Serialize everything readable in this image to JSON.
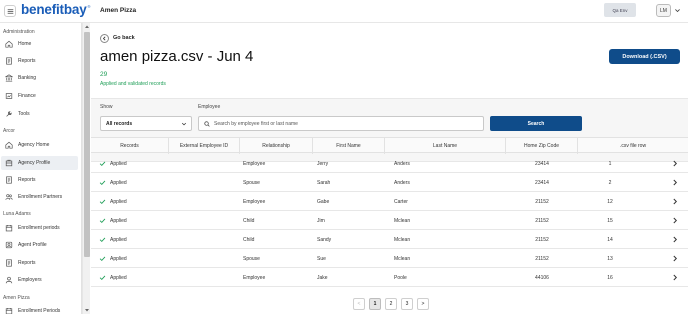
{
  "header": {
    "logo_text": "benefitbay",
    "logo_mark": "®",
    "company_name": "Amen Pizza",
    "env_label": "Qa Env",
    "user_initials": "LM"
  },
  "sidebar": {
    "sections": [
      {
        "title": "Administration",
        "items": [
          {
            "label": "Home",
            "icon": "home-icon"
          },
          {
            "label": "Reports",
            "icon": "report-icon"
          },
          {
            "label": "Banking",
            "icon": "bank-icon"
          },
          {
            "label": "Finance",
            "icon": "finance-icon"
          },
          {
            "label": "Tools",
            "icon": "tools-icon"
          }
        ]
      },
      {
        "title": "Arcor",
        "items": [
          {
            "label": "Agency Home",
            "icon": "home-icon"
          },
          {
            "label": "Agency Profile",
            "icon": "agency-icon",
            "active": true
          },
          {
            "label": "Reports",
            "icon": "report-icon"
          },
          {
            "label": "Enrollment Partners",
            "icon": "partners-icon"
          }
        ]
      },
      {
        "title": "Luna Adams",
        "items": [
          {
            "label": "Enrollment periods",
            "icon": "calendar-icon"
          },
          {
            "label": "Agent Profile",
            "icon": "profile-icon"
          },
          {
            "label": "Reports",
            "icon": "report-icon"
          },
          {
            "label": "Employers",
            "icon": "employers-icon"
          }
        ]
      },
      {
        "title": "Amen Pizza",
        "items": [
          {
            "label": "Enrollment Periods",
            "icon": "calendar-icon"
          }
        ]
      }
    ]
  },
  "main": {
    "back_label": "Go back",
    "title": "amen pizza.csv - Jun 4",
    "download_label": "Download (.CSV)",
    "record_count": "29",
    "record_count_label": "Applied and validated records",
    "filters": {
      "show_label": "Show",
      "show_value": "All records",
      "employee_label": "Employee",
      "employee_placeholder": "Search by employee first or last name",
      "search_label": "Search"
    },
    "table": {
      "columns": [
        "Records",
        "External Employee ID",
        "Relationship",
        "First Name",
        "Last Name",
        "Home Zip Code",
        ".csv file row"
      ],
      "rows": [
        {
          "status": "Applied",
          "ext_id": "",
          "relationship": "Employee",
          "first": "Jerry",
          "last": "Anders",
          "zip": "23414",
          "row": "1"
        },
        {
          "status": "Applied",
          "ext_id": "",
          "relationship": "Spouse",
          "first": "Sarah",
          "last": "Anders",
          "zip": "23414",
          "row": "2"
        },
        {
          "status": "Applied",
          "ext_id": "",
          "relationship": "Employee",
          "first": "Gabe",
          "last": "Carter",
          "zip": "21152",
          "row": "12"
        },
        {
          "status": "Applied",
          "ext_id": "",
          "relationship": "Child",
          "first": "Jim",
          "last": "Mclean",
          "zip": "21152",
          "row": "15"
        },
        {
          "status": "Applied",
          "ext_id": "",
          "relationship": "Child",
          "first": "Sandy",
          "last": "Mclean",
          "zip": "21152",
          "row": "14"
        },
        {
          "status": "Applied",
          "ext_id": "",
          "relationship": "Spouse",
          "first": "Sue",
          "last": "Mclean",
          "zip": "21152",
          "row": "13"
        },
        {
          "status": "Applied",
          "ext_id": "",
          "relationship": "Employee",
          "first": "Jake",
          "last": "Poole",
          "zip": "44106",
          "row": "16"
        }
      ]
    },
    "pagination": {
      "prev": "<",
      "pages": [
        "1",
        "2",
        "3"
      ],
      "current": "1",
      "next": ">"
    }
  },
  "colors": {
    "brand": "#1a5db8",
    "primary_button": "#0f4c8a",
    "success": "#1f9e57"
  }
}
